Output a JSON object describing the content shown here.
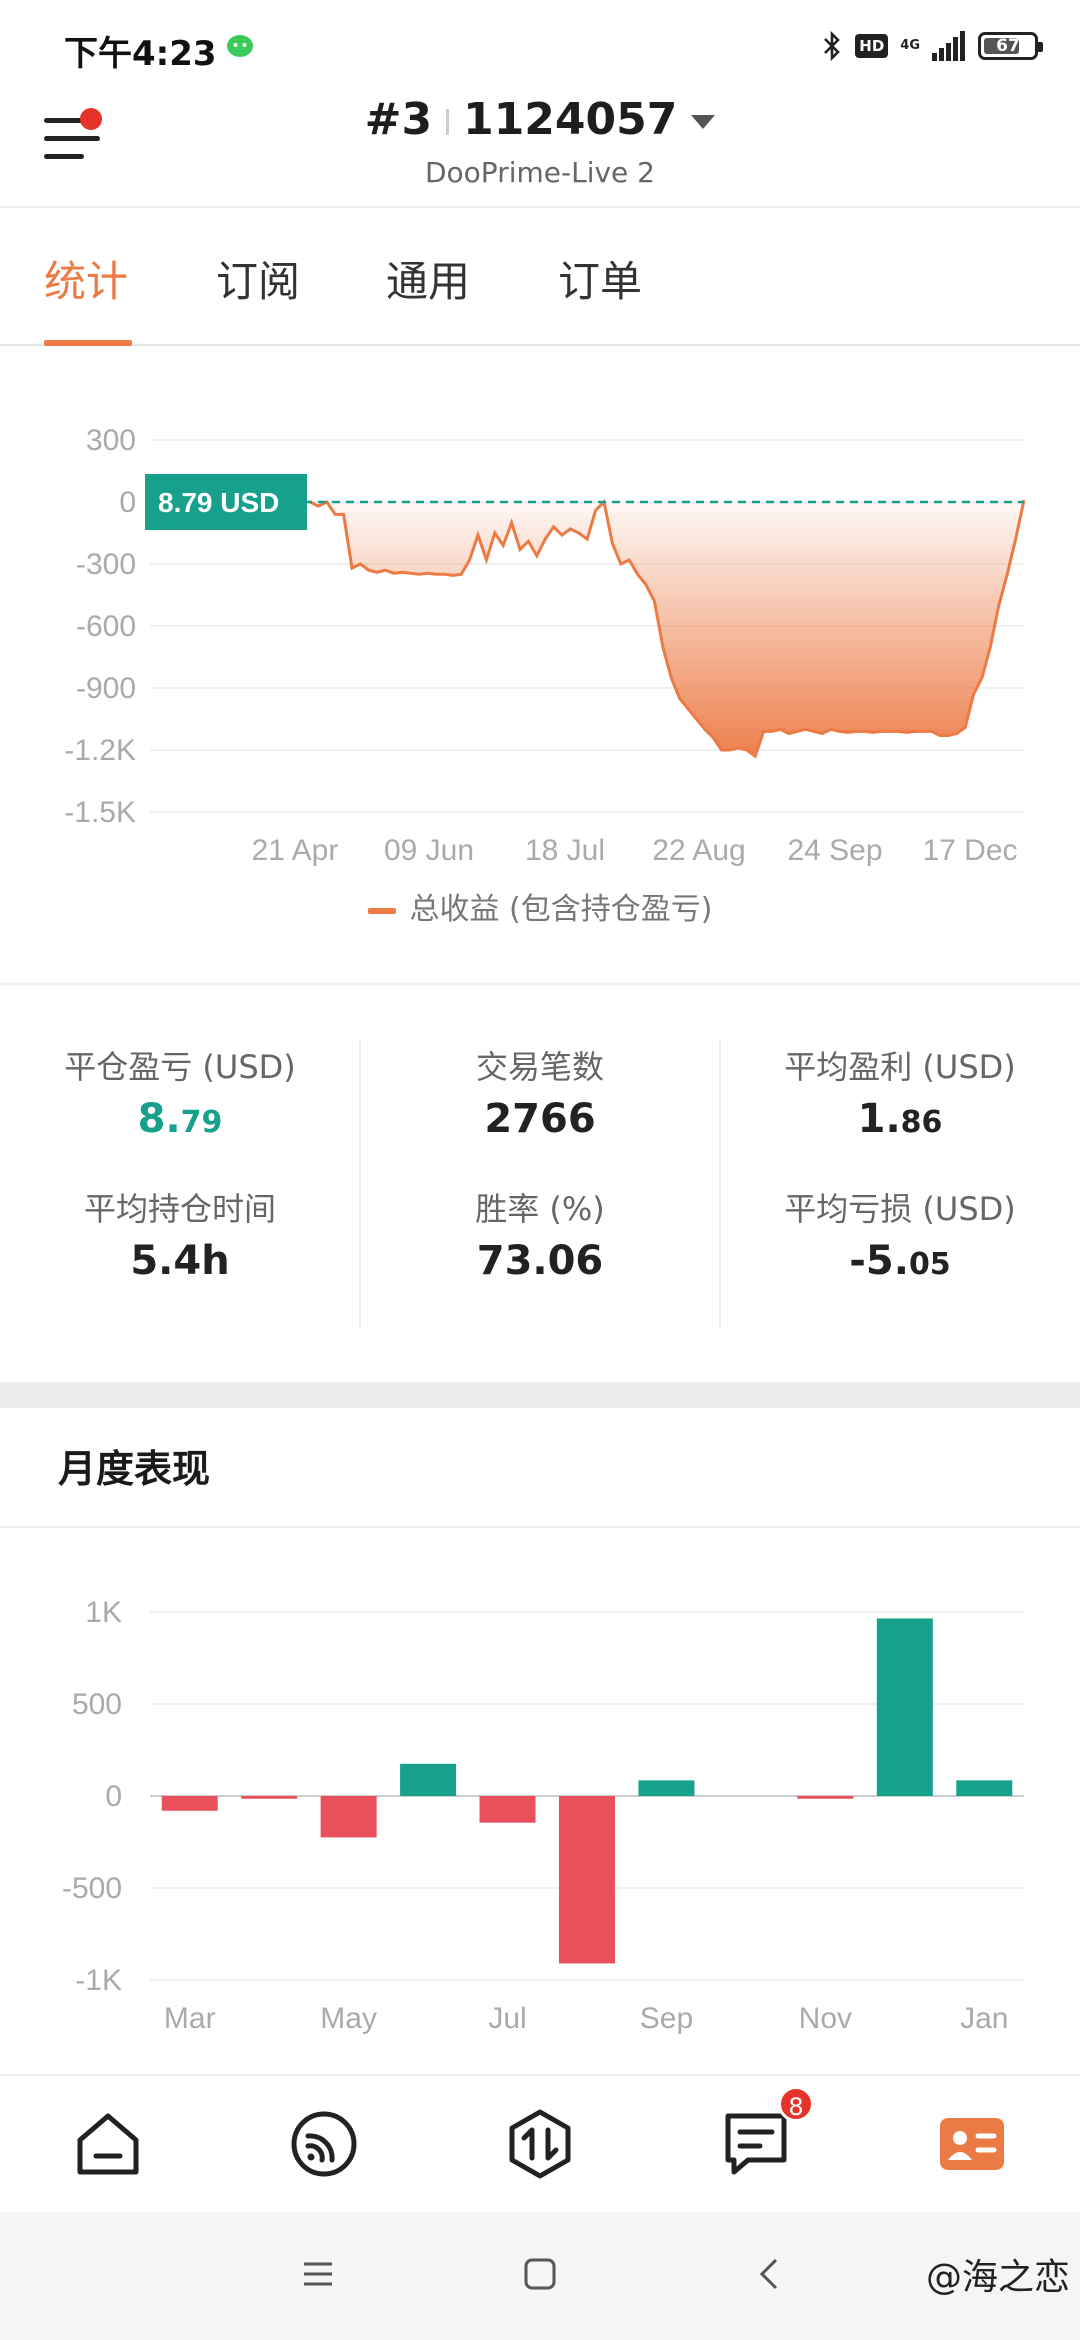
{
  "status_bar": {
    "time": "下午4:23",
    "hd_label": "HD",
    "network_label": "4G",
    "battery_level": "67",
    "icons": [
      "wechat-icon",
      "bluetooth-icon",
      "signal-icon",
      "battery-icon"
    ]
  },
  "header": {
    "account_prefix": "#3",
    "account_number": "1124057",
    "server": "DooPrime-Live 2",
    "notification_dot_color": "#e7322a"
  },
  "tabs": [
    {
      "label": "统计",
      "active": true
    },
    {
      "label": "订阅",
      "active": false
    },
    {
      "label": "通用",
      "active": false
    },
    {
      "label": "订单",
      "active": false
    }
  ],
  "colors": {
    "accent": "#ec7a44",
    "profit": "#17a08c",
    "loss": "#e8505b"
  },
  "chart_data": [
    {
      "type": "area",
      "current_value_label": "8.79 USD",
      "y_ticks": [
        "300",
        "0",
        "-300",
        "-600",
        "-900",
        "-1.2K",
        "-1.5K"
      ],
      "y_tick_values": [
        300,
        0,
        -300,
        -600,
        -900,
        -1200,
        -1500
      ],
      "x_tick_labels": [
        "21 Apr",
        "09 Jun",
        "18 Jul",
        "22 Aug",
        "24 Sep",
        "17 Dec"
      ],
      "ylim": [
        -1500,
        300
      ],
      "grid": true,
      "legend": "bottom",
      "series": [
        {
          "name": "总收益 (包含持仓盈亏)",
          "values": [
            0,
            -20,
            0,
            -60,
            -60,
            -320,
            -300,
            -330,
            -340,
            -330,
            -345,
            -340,
            -345,
            -350,
            -345,
            -350,
            -350,
            -355,
            -350,
            -280,
            -160,
            -280,
            -150,
            -210,
            -100,
            -230,
            -190,
            -260,
            -180,
            -120,
            -160,
            -130,
            -150,
            -180,
            -40,
            0,
            -200,
            -300,
            -280,
            -350,
            -400,
            -480,
            -700,
            -850,
            -950,
            -1000,
            -1050,
            -1100,
            -1140,
            -1200,
            -1200,
            -1190,
            -1200,
            -1230,
            -1110,
            -1110,
            -1100,
            -1120,
            -1110,
            -1100,
            -1110,
            -1120,
            -1100,
            -1110,
            -1115,
            -1110,
            -1110,
            -1115,
            -1110,
            -1110,
            -1110,
            -1115,
            -1110,
            -1110,
            -1110,
            -1130,
            -1130,
            -1120,
            -1090,
            -930,
            -850,
            -700,
            -500,
            -350,
            -180,
            8.79
          ]
        }
      ]
    },
    {
      "type": "bar",
      "title": "月度表现",
      "y_ticks": [
        "1K",
        "500",
        "0",
        "-500",
        "-1K"
      ],
      "y_tick_values": [
        1000,
        500,
        0,
        -500,
        -1000
      ],
      "categories": [
        "Mar",
        "Apr",
        "May",
        "Jun",
        "Jul",
        "Aug",
        "Sep",
        "Oct",
        "Nov",
        "Dec",
        "Jan"
      ],
      "x_tick_labels": [
        "Mar",
        "May",
        "Jul",
        "Sep",
        "Nov",
        "Jan"
      ],
      "ylim": [
        -1000,
        1000
      ],
      "grid": true,
      "values": [
        -80,
        -15,
        -225,
        175,
        -145,
        -910,
        85,
        0,
        -15,
        965,
        85
      ]
    }
  ],
  "legend": {
    "label": "总收益 (包含持仓盈亏)"
  },
  "stats": [
    {
      "label": "平仓盈亏 (USD)",
      "value_main": "8.",
      "value_small": "79",
      "color": "#17a08c"
    },
    {
      "label": "交易笔数",
      "value_main": "2766",
      "value_small": "",
      "color": "#222222"
    },
    {
      "label": "平均盈利 (USD)",
      "value_main": "1.",
      "value_small": "86",
      "color": "#222222"
    },
    {
      "label": "平均持仓时间",
      "value_main": "5.4h",
      "value_small": "",
      "color": "#222222"
    },
    {
      "label": "胜率 (%)",
      "value_main": "73.06",
      "value_small": "",
      "color": "#222222"
    },
    {
      "label": "平均亏损 (USD)",
      "value_main": "-5.",
      "value_small": "05",
      "color": "#222222"
    }
  ],
  "monthly": {
    "title": "月度表现"
  },
  "bottom_nav": {
    "items": [
      "home-icon",
      "signal-feed-icon",
      "trade-icon",
      "messages-icon",
      "profile-card-icon"
    ],
    "message_badge": "8",
    "active_index": 4
  },
  "watermark": "@海之恋"
}
